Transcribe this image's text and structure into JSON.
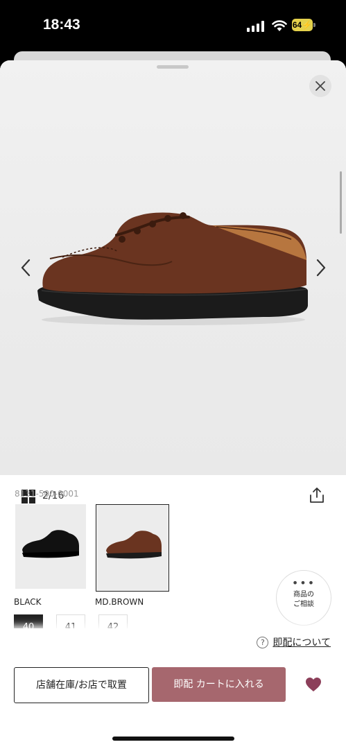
{
  "status_bar": {
    "time": "18:43",
    "battery": "64"
  },
  "gallery": {
    "counter": "2/16"
  },
  "product": {
    "code": "8131-500-0001"
  },
  "variants": [
    {
      "label": "BLACK"
    },
    {
      "label": "MD.BROWN"
    }
  ],
  "sizes": [
    "40",
    "41",
    "42"
  ],
  "consult": {
    "line1": "商品の",
    "line2": "ご相談"
  },
  "delivery_help": {
    "label": "即配について"
  },
  "actions": {
    "store_button": "店舗在庫/お店で取置",
    "cart_button": "即配 カートに入れる"
  },
  "colors": {
    "accent": "#a6676e",
    "heart": "#8c3f5a"
  }
}
